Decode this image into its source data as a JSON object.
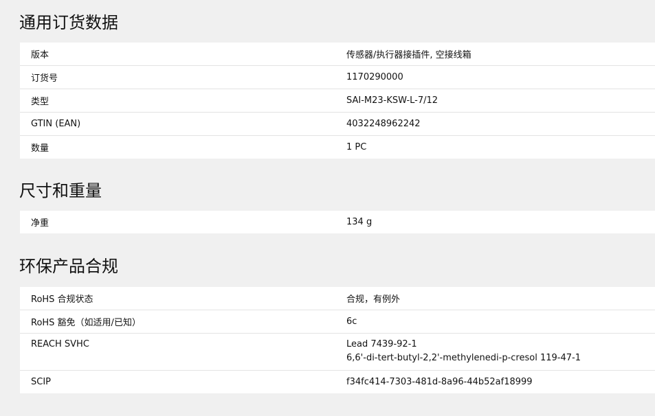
{
  "sections": [
    {
      "title": "通用订货数据",
      "rows": [
        {
          "label": "版本",
          "value": "传感器/执行器接插件, 空接线箱"
        },
        {
          "label": "订货号",
          "value": "1170290000"
        },
        {
          "label": "类型",
          "value": "SAI-M23-KSW-L-7/12"
        },
        {
          "label": "GTIN (EAN)",
          "value": "4032248962242"
        },
        {
          "label": "数量",
          "value": "1  PC"
        }
      ]
    },
    {
      "title": "尺寸和重量",
      "rows": [
        {
          "label": "净重",
          "value": "134  g"
        }
      ]
    },
    {
      "title": "环保产品合规",
      "rows": [
        {
          "label": "RoHS 合规状态",
          "value": "合规，有例外"
        },
        {
          "label": "RoHS 豁免（如适用/已知）",
          "value": "6c"
        },
        {
          "label": "REACH SVHC",
          "value_lines": [
            "Lead 7439-92-1",
            "6,6'-di-tert-butyl-2,2'-methylenedi-p-cresol 119-47-1"
          ]
        },
        {
          "label": "SCIP",
          "value": "f34fc414-7303-481d-8a96-44b52af18999"
        }
      ]
    }
  ]
}
